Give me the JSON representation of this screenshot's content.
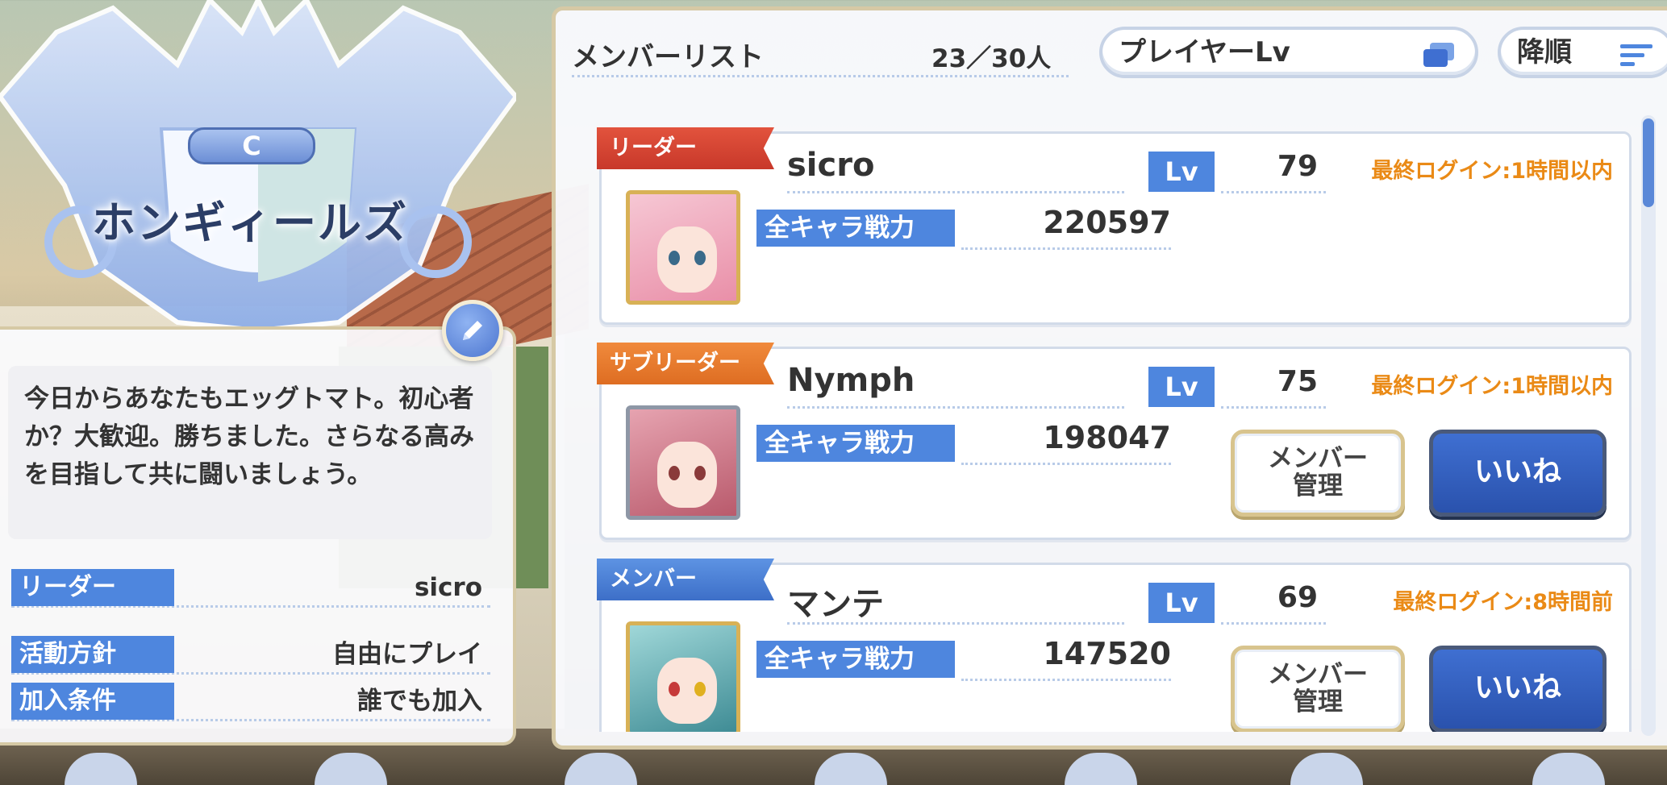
{
  "clan": {
    "grade": "C",
    "name": "ホンギィールズ",
    "description": "今日からあなたもエッグトマト。初心者か？大歓迎。勝ちました。さらなる高みを目指して共に闘いましょう。",
    "info": [
      {
        "label": "リーダー",
        "value": "sicro"
      },
      {
        "label": "活動方針",
        "value": "自由にプレイ"
      },
      {
        "label": "加入条件",
        "value": "誰でも加入"
      }
    ]
  },
  "member_list": {
    "title": "メンバーリスト",
    "count": "23／30人",
    "sort_key": "プレイヤーLv",
    "sort_order": "降順",
    "lv_label": "Lv",
    "power_label": "全キャラ戦力",
    "manage_label": "メンバー\n管理",
    "like_label": "いいね",
    "members": [
      {
        "role": "リーダー",
        "name": "sicro",
        "level": "79",
        "power": "220597",
        "last_login": "最終ログイン:1時間以内"
      },
      {
        "role": "サブリーダー",
        "name": "Nymph",
        "level": "75",
        "power": "198047",
        "last_login": "最終ログイン:1時間以内"
      },
      {
        "role": "メンバー",
        "name": "マンテ",
        "level": "69",
        "power": "147520",
        "last_login": "最終ログイン:8時間前"
      }
    ]
  },
  "colors": {
    "accent_blue": "#4e86de",
    "leader_red": "#d8442f",
    "subleader_orange": "#e87a2c",
    "member_blue": "#4a80d6",
    "login_orange": "#ea8a16"
  },
  "icons": [
    "pencil-icon",
    "copy-icon",
    "sort-descending-icon"
  ],
  "scroll_position": 0.0
}
